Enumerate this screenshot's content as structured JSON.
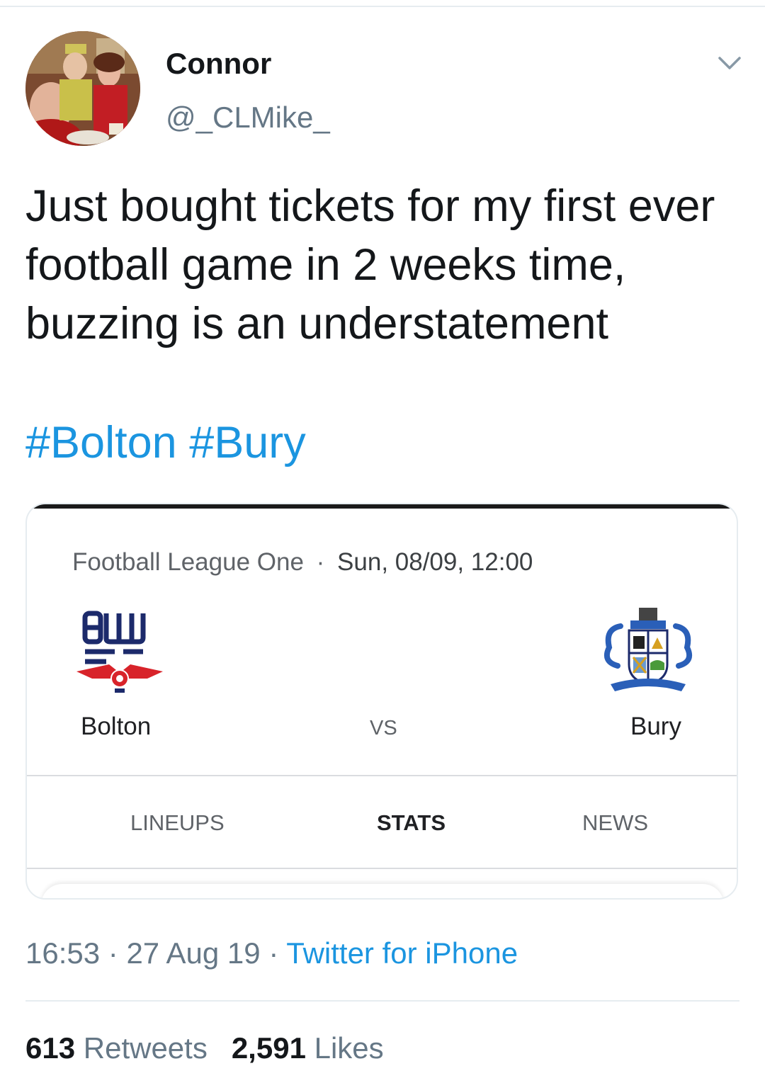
{
  "author": {
    "name": "Connor",
    "handle": "@_CLMike_"
  },
  "tweet": {
    "text": "Just bought tickets for my first ever football game in 2 weeks time, buzzing is an understatement",
    "hashtags": [
      "#Bolton",
      "#Bury"
    ]
  },
  "card": {
    "league": "Football League One",
    "separator": "·",
    "datetime": "Sun, 08/09, 12:00",
    "home_team": "Bolton",
    "away_team": "Bury",
    "vs_label": "VS",
    "tabs": [
      "LINEUPS",
      "STATS",
      "NEWS"
    ]
  },
  "meta": {
    "time": "16:53",
    "separator": "·",
    "date": "27 Aug 19",
    "source": "Twitter for iPhone"
  },
  "engagement": {
    "retweets_count": "613",
    "retweets_label": "Retweets",
    "likes_count": "2,591",
    "likes_label": "Likes"
  },
  "colors": {
    "link": "#1b95e0",
    "muted": "#657786",
    "text": "#14171a"
  },
  "icons": {
    "caret": "chevron-down-icon"
  }
}
